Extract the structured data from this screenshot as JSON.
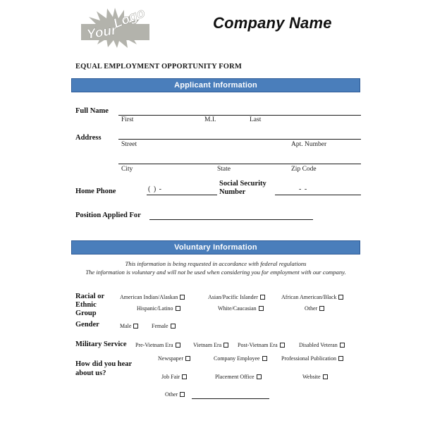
{
  "header": {
    "logo_text": "Your Logo",
    "logo_icon": "starburst-logo",
    "company_name": "Company Name"
  },
  "form_title": "EQUAL EMPLOYMENT OPPORTUNITY FORM",
  "sections": {
    "applicant": {
      "bar_label": "Applicant Information",
      "fields": {
        "full_name_label": "Full Name",
        "first_label": "First",
        "mi_label": "M.I.",
        "last_label": "Last",
        "address_label": "Address",
        "street_label": "Street",
        "apt_label": "Apt. Number",
        "city_label": "City",
        "state_label": "State",
        "zip_label": "Zip Code",
        "home_phone_label": "Home Phone",
        "phone_value": "(        )          -",
        "ssn_label_line1": "Social Security",
        "ssn_label_line2": "Number",
        "ssn_value": "-             -",
        "position_label": "Position Applied For"
      }
    },
    "voluntary": {
      "bar_label": "Voluntary Information",
      "note_line1": "This information is being requested in accordance with federal regulations",
      "note_line2": "The information is voluntary and will not be used when considering you for employment with our company.",
      "racial_label_lines": [
        "Racial or",
        "Ethnic",
        "Group"
      ],
      "racial_options": [
        "American Indian/Alaskan",
        "Asian/Pacific Islander",
        "African American/Black",
        "Hispanic/Latino",
        "White/Caucasian",
        "Other"
      ],
      "gender_label": "Gender",
      "gender_options": [
        "Male",
        "Female"
      ],
      "military_label": "Military Service",
      "military_options": [
        "Pre-Vietnam Era",
        "Vietnam Era",
        "Post-Vietnam Era",
        "Disabled Veteran"
      ],
      "hear_label_lines": [
        "How did you hear",
        "about us?"
      ],
      "hear_options": [
        "Newspaper",
        "Company Employee",
        "Professional Publication",
        "Job Fair",
        "Placement Office",
        "Website",
        "Other"
      ]
    }
  },
  "colors": {
    "bar_fill": "#4a7ebb",
    "bar_border": "#2e5b96",
    "text": "#1a1a1a",
    "logo_gray": "#b3b3ac",
    "page_background": "#ffffff"
  }
}
